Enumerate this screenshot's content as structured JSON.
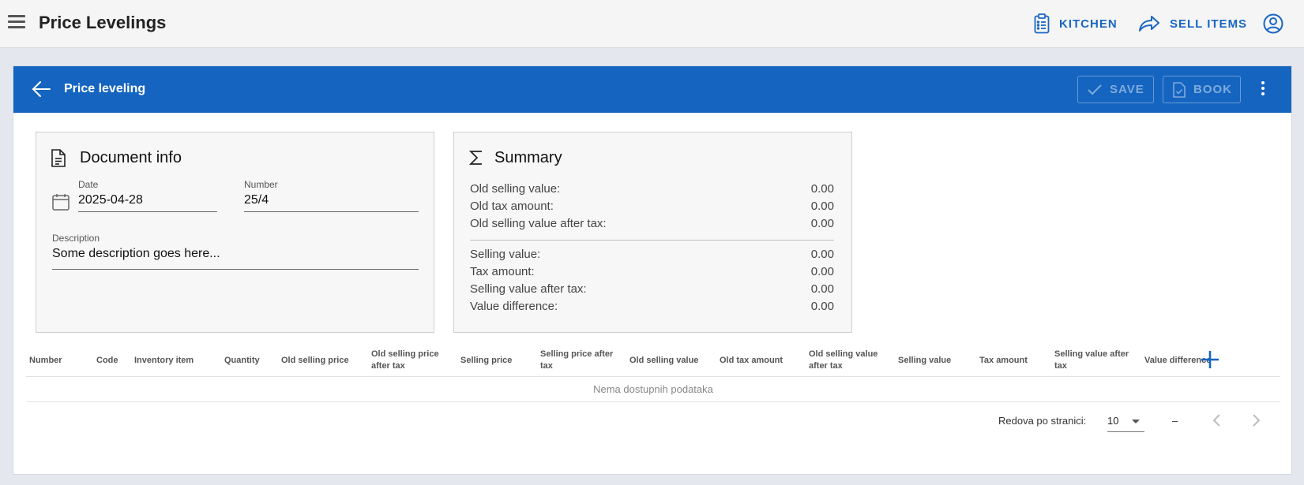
{
  "appbar": {
    "title": "Price Levelings",
    "kitchen_label": "KITCHEN",
    "sell_items_label": "SELL ITEMS"
  },
  "header": {
    "title": "Price leveling",
    "save_label": "SAVE",
    "book_label": "BOOK"
  },
  "document_info": {
    "title": "Document info",
    "date_label": "Date",
    "date_value": "2025-04-28",
    "number_label": "Number",
    "number_value": "25/4",
    "description_label": "Description",
    "description_value": "Some description goes here..."
  },
  "summary": {
    "title": "Summary",
    "rows": [
      {
        "label": "Old selling value:",
        "value": "0.00"
      },
      {
        "label": "Old tax amount:",
        "value": "0.00"
      },
      {
        "label": "Old selling value after tax:",
        "value": "0.00"
      },
      {
        "label": "Selling value:",
        "value": "0.00"
      },
      {
        "label": "Tax amount:",
        "value": "0.00"
      },
      {
        "label": "Selling value after tax:",
        "value": "0.00"
      },
      {
        "label": "Value difference:",
        "value": "0.00"
      }
    ]
  },
  "table": {
    "columns": [
      {
        "line1": "Number",
        "line2": ""
      },
      {
        "line1": "Code",
        "line2": ""
      },
      {
        "line1": "Inventory item",
        "line2": ""
      },
      {
        "line1": "Quantity",
        "line2": ""
      },
      {
        "line1": "Old selling price",
        "line2": ""
      },
      {
        "line1": "Old selling price",
        "line2": "after tax"
      },
      {
        "line1": "Selling price",
        "line2": ""
      },
      {
        "line1": "Selling price after",
        "line2": "tax"
      },
      {
        "line1": "Old selling value",
        "line2": ""
      },
      {
        "line1": "Old tax amount",
        "line2": ""
      },
      {
        "line1": "Old selling value",
        "line2": "after tax"
      },
      {
        "line1": "Selling value",
        "line2": ""
      },
      {
        "line1": "Tax amount",
        "line2": ""
      },
      {
        "line1": "Selling value after",
        "line2": "tax"
      },
      {
        "line1": "Value difference",
        "line2": ""
      }
    ],
    "empty_text": "Nema dostupnih podataka"
  },
  "pagination": {
    "rows_per_page_label": "Redova po stranici:",
    "rows_per_page_value": "10",
    "range_text": "–"
  },
  "colors": {
    "accent": "#1565c0",
    "link": "#1a66c4"
  }
}
